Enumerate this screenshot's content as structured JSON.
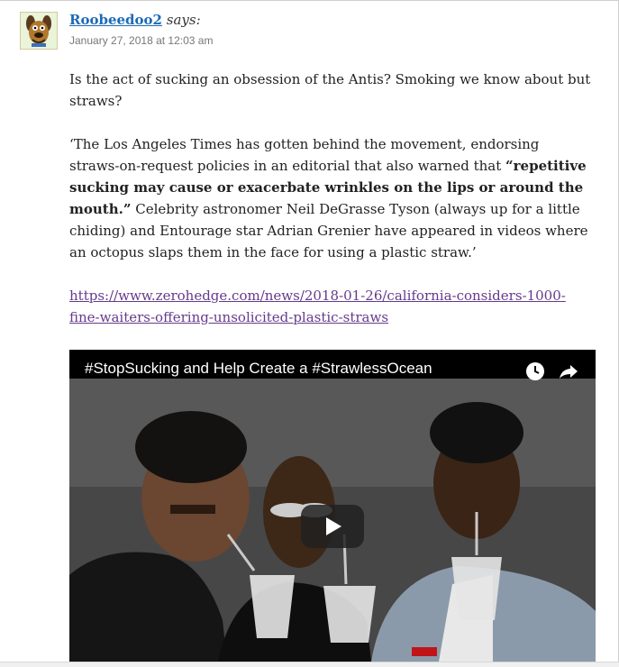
{
  "comment": {
    "author": "Roobeedoo2",
    "says": "says:",
    "date": "January 27, 2018 at 12:03 am",
    "paragraph1": "Is the act of sucking an obsession of the Antis? Smoking we know about but straws?",
    "paragraph2_start": "‘The Los Angeles Times has gotten behind the movement, endorsing straws-on-request policies in an editorial that also warned that ",
    "paragraph2_bold": "“repetitive sucking may cause or exacerbate wrinkles on the lips or around the mouth.”",
    "paragraph2_end": " Celebrity astronomer Neil DeGrasse Tyson (always up for a little chiding) and Entourage star Adrian Grenier have appeared in videos where an octopus slaps them in the face for using a plastic straw.’",
    "link": "https://www.zerohedge.com/news/2018-01-26/california-considers-1000-fine-waiters-offering-unsolicited-plastic-straws"
  },
  "video": {
    "title": "#StopSucking and Help Create a #StrawlessOcean",
    "watch_later_icon": "clock-icon",
    "share_icon": "share-arrow-icon",
    "play_icon": "play-icon"
  },
  "colors": {
    "author_link": "#1e6bb8",
    "visited_link": "#663a8c",
    "date": "#777777"
  }
}
